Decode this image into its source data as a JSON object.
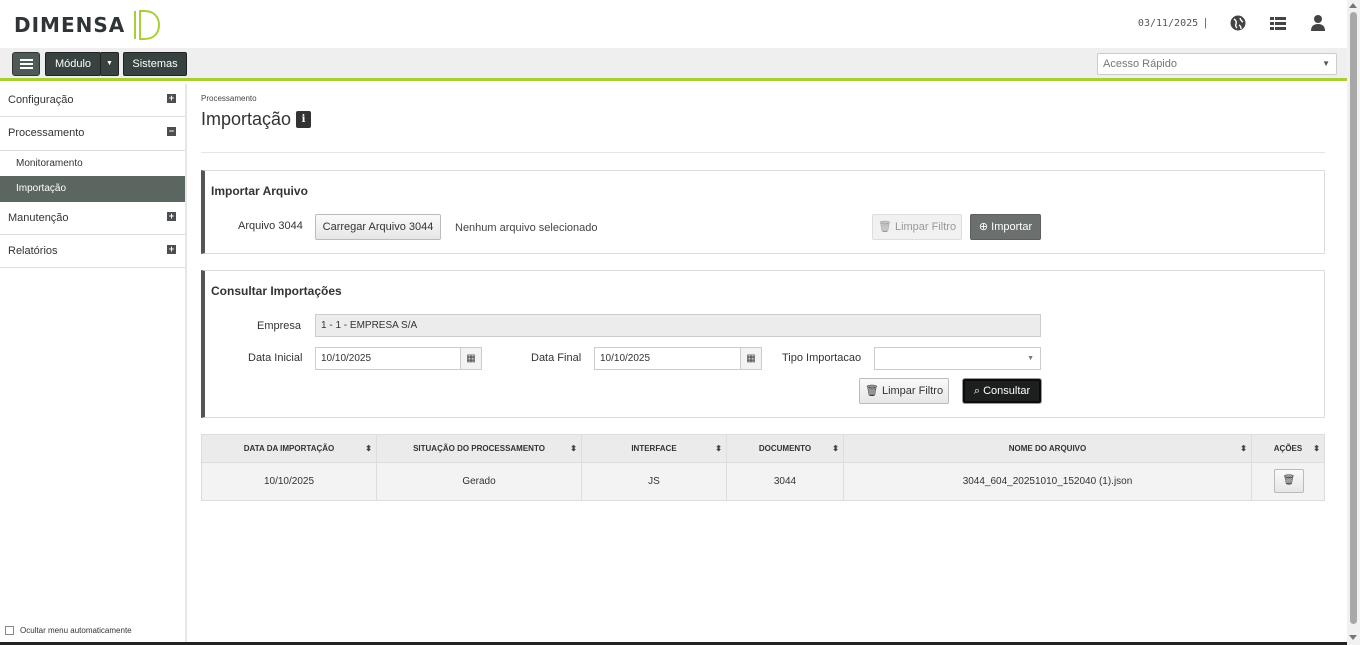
{
  "header": {
    "brand": "DIMENSA",
    "date": "03/11/2025",
    "separator": "|",
    "icons": [
      "globe-icon",
      "list-icon",
      "user-icon"
    ]
  },
  "navbar": {
    "modulo": "Módulo",
    "sistemas": "Sistemas",
    "quick_access_placeholder": "Acesso Rápido",
    "accent": "#a8cf38"
  },
  "sidebar": {
    "items": [
      {
        "label": "Configuração",
        "toggle": "+"
      },
      {
        "label": "Processamento",
        "toggle": "−"
      },
      {
        "label": "Manutenção",
        "toggle": "+"
      },
      {
        "label": "Relatórios",
        "toggle": "+"
      }
    ],
    "subitems": [
      {
        "label": "Monitoramento"
      },
      {
        "label": "Importação"
      }
    ],
    "hide_menu_label": "Ocultar menu automaticamente"
  },
  "main": {
    "breadcrumb": "Processamento",
    "title": "Importação",
    "info_badge": "i",
    "import_panel": {
      "title": "Importar Arquivo",
      "file_label": "Arquivo 3044",
      "upload_button": "Carregar Arquivo 3044",
      "no_file_text": "Nenhum arquivo selecionado",
      "clear_button": "Limpar Filtro",
      "import_button": "Importar"
    },
    "query_panel": {
      "title": "Consultar Importações",
      "empresa_label": "Empresa",
      "empresa_value": "1 - 1 - EMPRESA S/A",
      "data_inicial_label": "Data Inicial",
      "data_inicial_value": "10/10/2025",
      "data_final_label": "Data Final",
      "data_final_value": "10/10/2025",
      "tipo_label": "Tipo Importacao",
      "tipo_value": "",
      "clear_button": "Limpar Filtro",
      "search_button": "Consultar"
    },
    "table": {
      "columns": [
        "DATA DA IMPORTAÇÃO",
        "SITUAÇÃO DO PROCESSAMENTO",
        "INTERFACE",
        "DOCUMENTO",
        "NOME DO ARQUIVO",
        "AÇÕES"
      ],
      "rows": [
        [
          "10/10/2025",
          "Gerado",
          "JS",
          "3044",
          "3044_604_20251010_152040 (1).json",
          ""
        ]
      ]
    }
  }
}
